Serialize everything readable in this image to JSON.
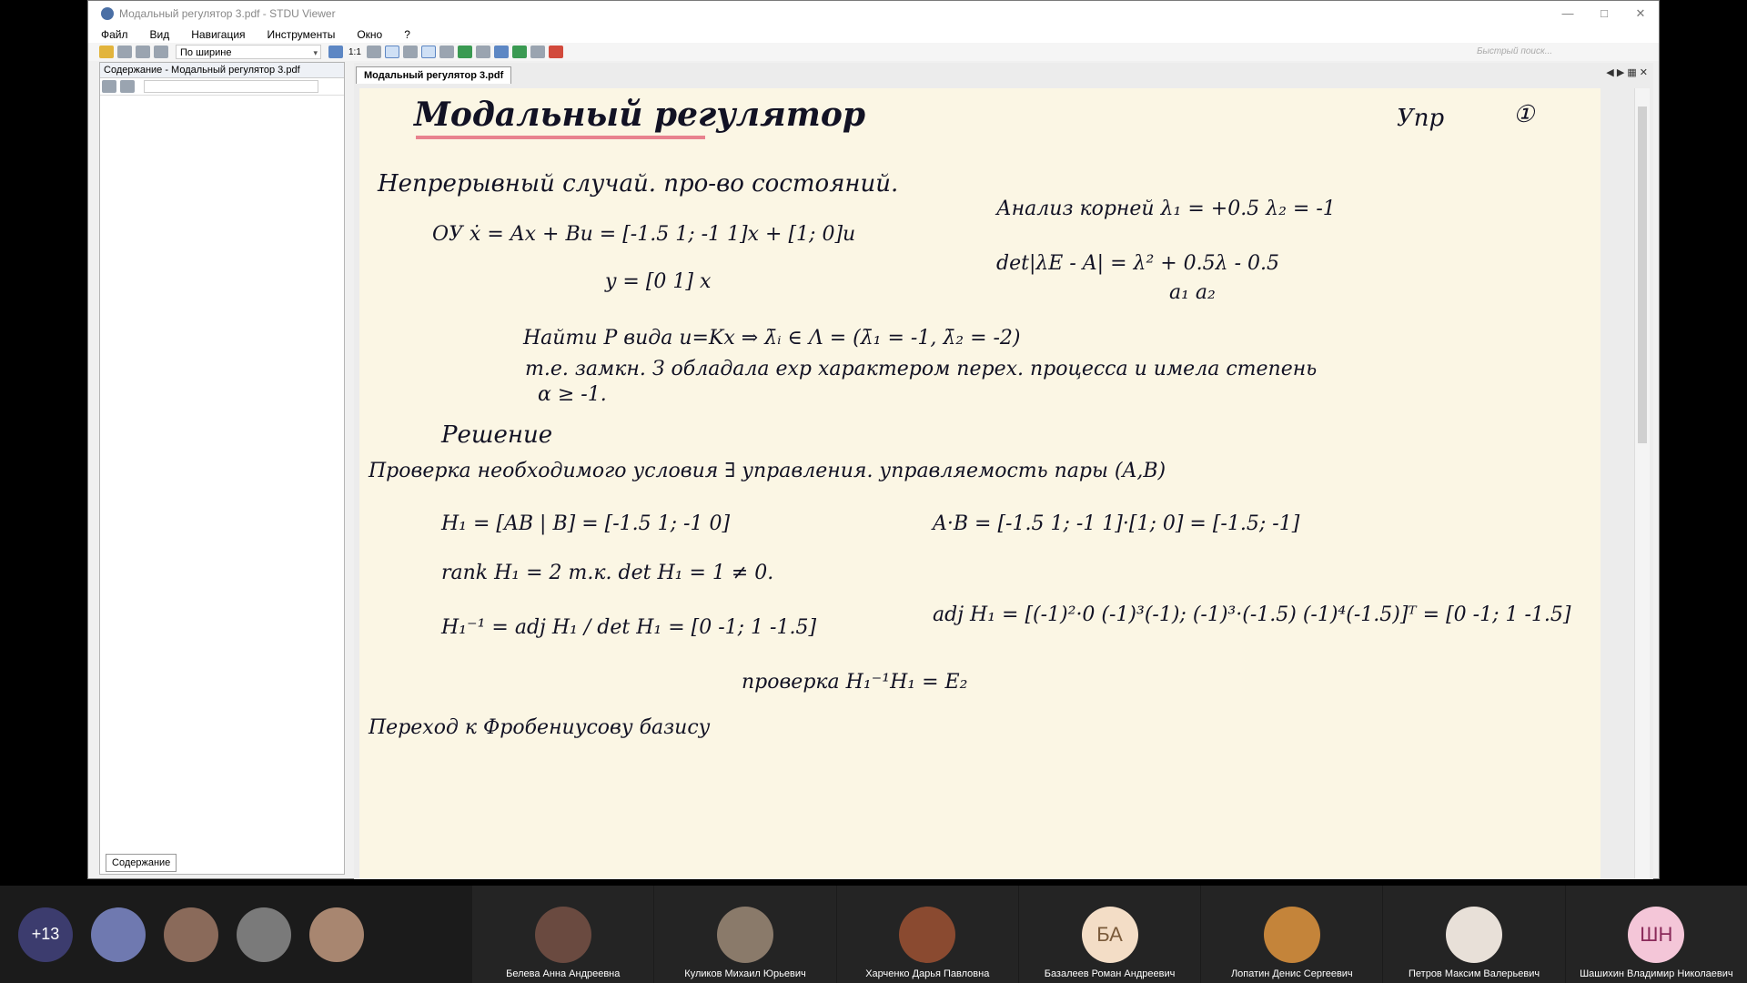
{
  "window": {
    "title": "Модальный регулятор 3.pdf - STDU Viewer"
  },
  "menu": [
    "Файл",
    "Вид",
    "Навигация",
    "Инструменты",
    "Окно",
    "?"
  ],
  "toolbar": {
    "zoom_mode": "По ширине",
    "page_ratio": "1:1",
    "search_placeholder": "Быстрый поиск..."
  },
  "sidebar": {
    "header": "Содержание - Модальный регулятор 3.pdf",
    "tab": "Содержание"
  },
  "document": {
    "tab": "Модальный регулятор 3.pdf"
  },
  "page": {
    "title": "Модальный регулятор",
    "corner": "Упр",
    "page_num": "①",
    "line1": "Непрерывный случай. про-во состояний.",
    "line2": "ОУ  ẋ = Ax + Bu = [-1.5 1; -1 1]x + [1; 0]u",
    "line3": "y = [0 1] x",
    "line4": "Найти P вида u=Kx ⇒ λ̄ᵢ ∈ Λ = (λ̄₁ = -1, λ̄₂ = -2)",
    "line5": "т.е. замкн. З обладала exp характером перех. процесса и имела степень",
    "line6": "α ≥ -1.",
    "line7": "Решение",
    "line8": "Проверка необходимого условия ∃ управления. управляемость пары (A,B)",
    "line9": "H₁ = [AB | B] = [-1.5 1; -1 0]",
    "line10": "rank H₁ = 2  т.к. det H₁ = 1 ≠ 0.",
    "line11": "H₁⁻¹ = adj H₁ / det H₁ = [0 -1; 1 -1.5]",
    "line12": "проверка H₁⁻¹H₁ = E₂",
    "line13": "Переход к Фробениусову базису",
    "r1": "Анализ корней λ₁ = +0.5  λ₂ = -1",
    "r2": "det|λE - A| = λ² + 0.5λ - 0.5",
    "r3": "a₁   a₂",
    "r4": "A·B = [-1.5 1; -1 1]·[1; 0] = [-1.5; -1]",
    "r5": "adj H₁ = [(-1)²·0  (-1)³(-1); (-1)³·(-1.5)  (-1)⁴(-1.5)]ᵀ = [0 -1; 1 -1.5]"
  },
  "call": {
    "more_count": "+13",
    "participants": [
      {
        "name": "Белева Анна Андреевна",
        "initials": ""
      },
      {
        "name": "Куликов Михаил Юрьевич",
        "initials": ""
      },
      {
        "name": "Харченко Дарья Павловна",
        "initials": ""
      },
      {
        "name": "Базалеев Роман Андреевич",
        "initials": "БА"
      },
      {
        "name": "Лопатин Денис Сергеевич",
        "initials": ""
      },
      {
        "name": "Петров Максим Валерьевич",
        "initials": ""
      },
      {
        "name": "Шашихин Владимир Николаевич",
        "initials": "ШН"
      }
    ]
  }
}
